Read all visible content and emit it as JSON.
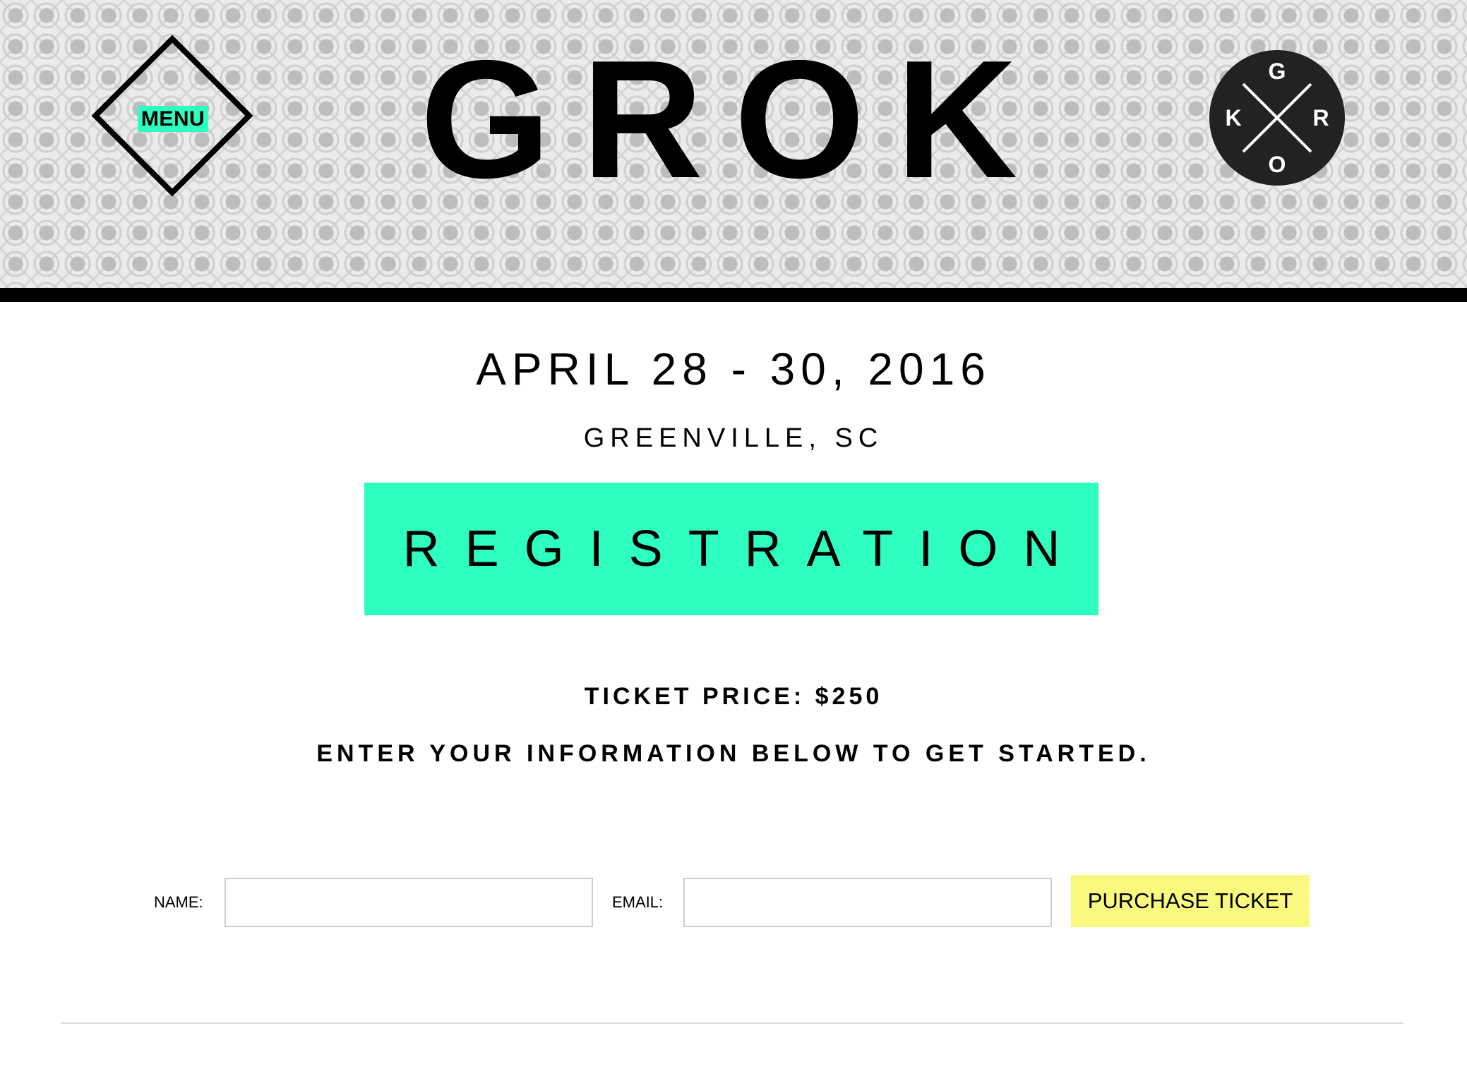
{
  "header": {
    "menu_label": "MENU",
    "brand_title": "GROK",
    "badge_letters": {
      "top": "G",
      "left": "K",
      "right": "R",
      "bottom": "O"
    }
  },
  "event": {
    "dates": "APRIL 28 - 30, 2016",
    "location": "GREENVILLE, SC"
  },
  "registration": {
    "heading": "REGISTRATION",
    "ticket_price": "TICKET PRICE: $250",
    "instructions": "ENTER YOUR INFORMATION BELOW TO GET STARTED."
  },
  "form": {
    "name_label": "NAME:",
    "name_value": "",
    "email_label": "EMAIL:",
    "email_value": "",
    "purchase_label": "PURCHASE TICKET"
  },
  "colors": {
    "accent_mint": "#2effc0",
    "button_yellow": "#f9f97f",
    "badge_dark": "#222222"
  }
}
